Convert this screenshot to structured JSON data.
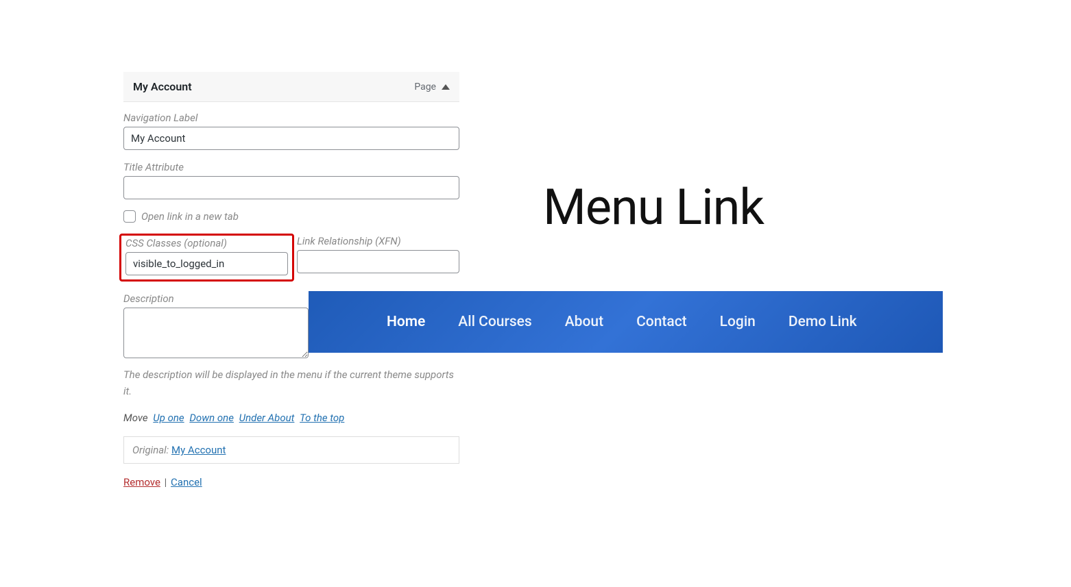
{
  "menu_item": {
    "title": "My Account",
    "type": "Page",
    "fields": {
      "nav_label": {
        "label": "Navigation Label",
        "value": "My Account"
      },
      "title_attr": {
        "label": "Title Attribute",
        "value": ""
      },
      "new_tab": {
        "label": "Open link in a new tab"
      },
      "css_classes": {
        "label": "CSS Classes (optional)",
        "value": "visible_to_logged_in"
      },
      "xfn": {
        "label": "Link Relationship (XFN)",
        "value": ""
      },
      "description": {
        "label": "Description",
        "value": "",
        "help": "The description will be displayed in the menu if the current theme supports it."
      }
    },
    "move": {
      "label": "Move",
      "links": [
        "Up one",
        "Down one",
        "Under About",
        "To the top"
      ]
    },
    "original": {
      "label": "Original:",
      "value": "My Account"
    },
    "actions": {
      "remove": "Remove",
      "cancel": "Cancel"
    }
  },
  "annotation_title": "Menu Link",
  "navbar": {
    "items": [
      {
        "label": "Home",
        "active": true
      },
      {
        "label": "All Courses",
        "active": false
      },
      {
        "label": "About",
        "active": false
      },
      {
        "label": "Contact",
        "active": false
      },
      {
        "label": "Login",
        "active": false
      },
      {
        "label": "Demo Link",
        "active": false
      }
    ]
  }
}
